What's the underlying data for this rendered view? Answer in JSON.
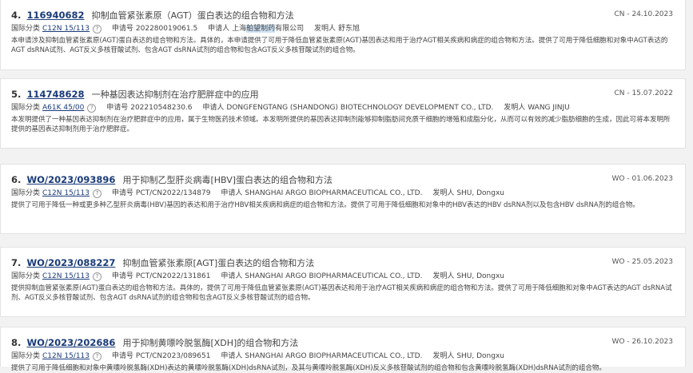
{
  "labels": {
    "ipc": "国际分类",
    "appno": "申请号",
    "applicant": "申请人",
    "inventor": "发明人",
    "help": "?"
  },
  "results": [
    {
      "index": "4.",
      "pubno": "116940682",
      "title": "抑制血管紧张素原（AGT）蛋白表达的组合物和方法",
      "date": "CN - 24.10.2023",
      "ipc": "C12N 15/113",
      "appno": "202280019061.5",
      "applicant_pre": "上海",
      "applicant_hl": "舶望制药",
      "applicant_post": "有限公司",
      "inventor": "舒东旭",
      "abstract": "本申请涉及抑制血管紧张素原(AGT)蛋白表达的组合物和方法。具体的，本申请提供了可用于降低血管紧张素原(AGT)基因表达和用于治疗AGT相关疾病和病症的组合物和方法。提供了可用于降低细胞和对象中AGT表达的AGT dsRNA试剂、AGT反义多核苷酸试剂、包含AGT dsRNA试剂的组合物和包含AGT反义多核苷酸试剂的组合物。"
    },
    {
      "index": "5.",
      "pubno": "114748628",
      "title": "一种基因表达抑制剂在治疗肥胖症中的应用",
      "date": "CN - 15.07.2022",
      "ipc": "A61K 45/00",
      "appno": "202210548230.6",
      "applicant_pre": "DONGFENGTANG (SHANDONG) BIOTECHNOLOGY DEVELOPMENT CO., LTD.",
      "applicant_hl": "",
      "applicant_post": "",
      "inventor": "WANG JINJU",
      "abstract": "本发明提供了一种基因表达抑制剂在治疗肥胖症中的应用，属于生物医药技术领域。本发明所提供的基因表达抑制剂能够抑制脂肪间充质干细胞的增殖和成脂分化，从而可以有效的减少脂肪细胞的生成，因此可将本发明所提供的基因表达抑制剂用于治疗肥胖症。"
    },
    {
      "index": "6.",
      "pubno": "WO/2023/093896",
      "title": "用于抑制乙型肝炎病毒[HBV]蛋白表达的组合物和方法",
      "date": "WO - 01.06.2023",
      "ipc": "C12N 15/113",
      "appno": "PCT/CN2022/134879",
      "applicant_pre": "SHANGHAI ARGO BIOPHARMACEUTICAL CO., LTD.",
      "applicant_hl": "",
      "applicant_post": "",
      "inventor": "SHU, Dongxu",
      "abstract": "提供了可用于降低一种或更多种乙型肝炎病毒(HBV)基因的表达和用于治疗HBV相关疾病和病症的组合物和方法。提供了可用于降低细胞和对象中的HBV表达的HBV dsRNA剂以及包含HBV dsRNA剂的组合物。"
    },
    {
      "index": "7.",
      "pubno": "WO/2023/088227",
      "title": "抑制血管紧张素原[AGT]蛋白表达的组合物和方法",
      "date": "WO - 25.05.2023",
      "ipc": "C12N 15/113",
      "appno": "PCT/CN2022/131861",
      "applicant_pre": "SHANGHAI ARGO BIOPHARMACEUTICAL CO., LTD.",
      "applicant_hl": "",
      "applicant_post": "",
      "inventor": "SHU, Dongxu",
      "abstract": "提供抑制血管紧张素原(AGT)蛋白表达的组合物和方法。具体的，提供了可用于降低血管紧张素原(AGT)基因表达和用于治疗AGT相关疾病和病症的组合物和方法。提供了可用于降低细胞和对象中AGT表达的AGT dsRNA试剂、AGT反义多核苷酸试剂、包含AGT dsRNA试剂的组合物和包含AGT反义多核苷酸试剂的组合物。"
    },
    {
      "index": "8.",
      "pubno": "WO/2023/202686",
      "title": "用于抑制黄嘌呤脱氢酶[XDH]的组合物和方法",
      "date": "WO - 26.10.2023",
      "ipc": "C12N 15/113",
      "appno": "PCT/CN2023/089651",
      "applicant_pre": "SHANGHAI ARGO BIOPHARMACEUTICAL CO., LTD.",
      "applicant_hl": "",
      "applicant_post": "",
      "inventor": "SHU, Dongxu",
      "abstract": "提供了可用于降低细胞和对象中黄嘌呤脱氢酶(XDH)表达的黄嘌呤脱氢酶(XDH)dsRNA试剂，及其与黄嘌呤脱氢酶(XDH)反义多核苷酸试剂的组合物和包含黄嘌呤脱氢酶(XDH)dsRNA试剂的组合物。"
    }
  ]
}
